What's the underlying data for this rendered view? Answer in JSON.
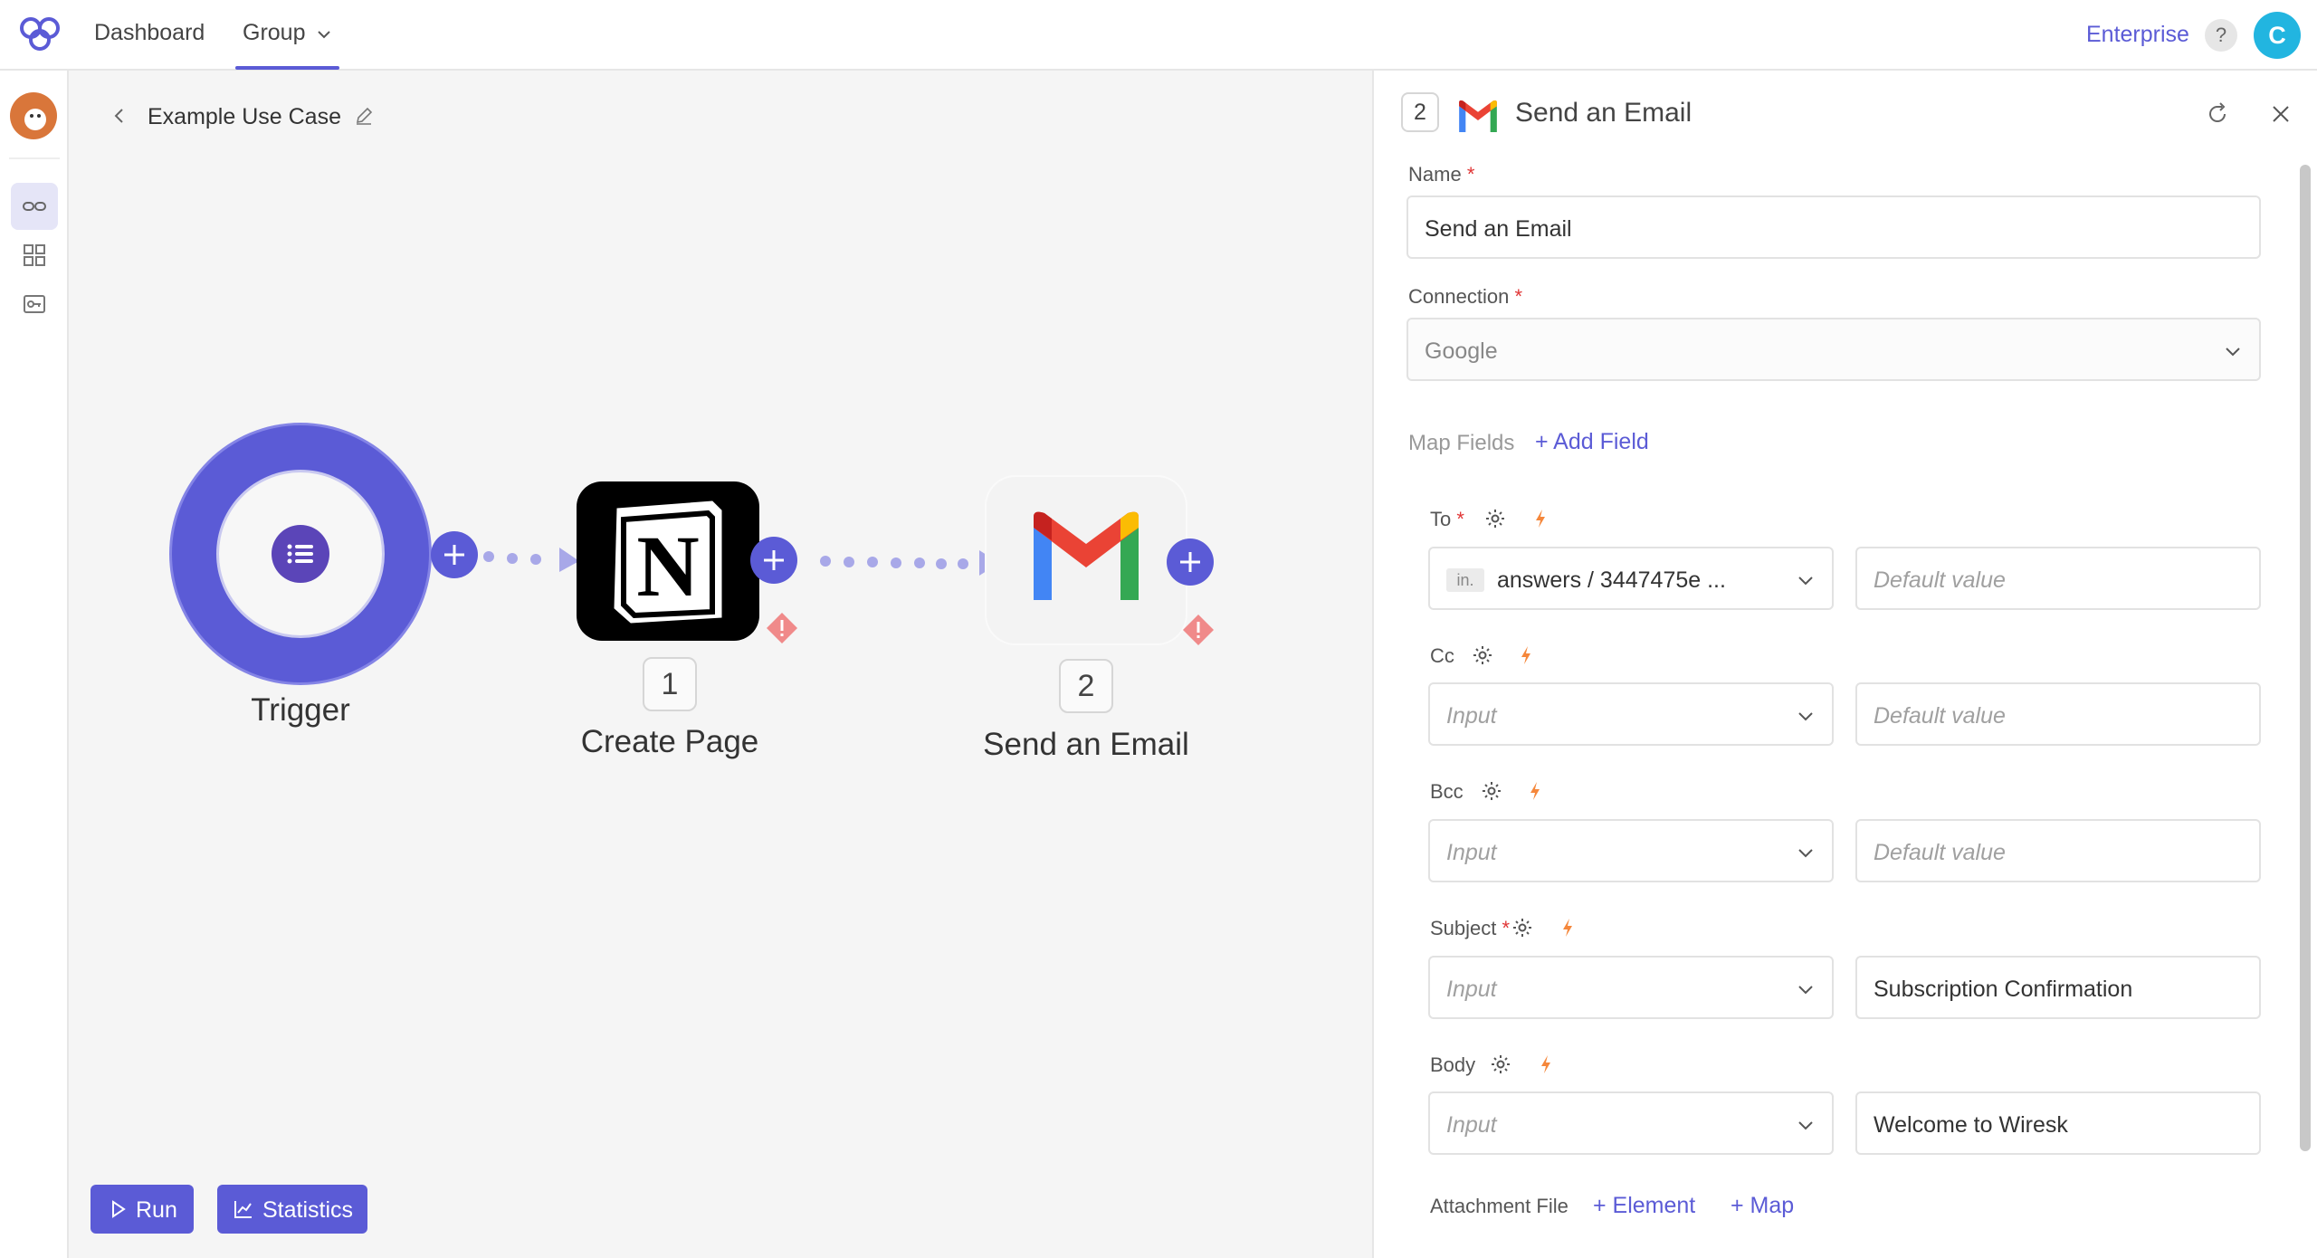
{
  "topbar": {
    "nav": [
      {
        "label": "Dashboard"
      },
      {
        "label": "Group"
      }
    ],
    "enterprise": "Enterprise",
    "help": "?",
    "user_initial": "C"
  },
  "breadcrumb": {
    "title": "Example Use Case"
  },
  "canvas": {
    "nodes": [
      {
        "label": "Trigger"
      },
      {
        "step": "1",
        "label": "Create Page",
        "icon": "notion-icon"
      },
      {
        "step": "2",
        "label": "Send an Email",
        "icon": "gmail-icon"
      }
    ]
  },
  "actions": {
    "run": "Run",
    "statistics": "Statistics"
  },
  "panel": {
    "step": "2",
    "title": "Send an Email",
    "name_label": "Name",
    "name_value": "Send an Email",
    "connection_label": "Connection",
    "connection_value": "Google",
    "map_fields_label": "Map Fields",
    "add_field": "+ Add Field",
    "fields": [
      {
        "label": "To",
        "required": true,
        "chip": "in.",
        "input": "answers / 3447475e ...",
        "default": "Default value"
      },
      {
        "label": "Cc",
        "required": false,
        "input": "Input",
        "default": "Default value"
      },
      {
        "label": "Bcc",
        "required": false,
        "input": "Input",
        "default": "Default value"
      },
      {
        "label": "Subject",
        "required": true,
        "input": "Input",
        "default": "Subscription Confirmation"
      },
      {
        "label": "Body",
        "required": false,
        "input": "Input",
        "default": "Welcome to Wiresk"
      }
    ],
    "attachment_label": "Attachment File",
    "attachment_element": "+ Element",
    "attachment_map": "+ Map"
  },
  "colors": {
    "accent": "#5b5bd6",
    "required": "#e03535",
    "warning": "#f08a8a",
    "bolt": "#f5873b"
  }
}
